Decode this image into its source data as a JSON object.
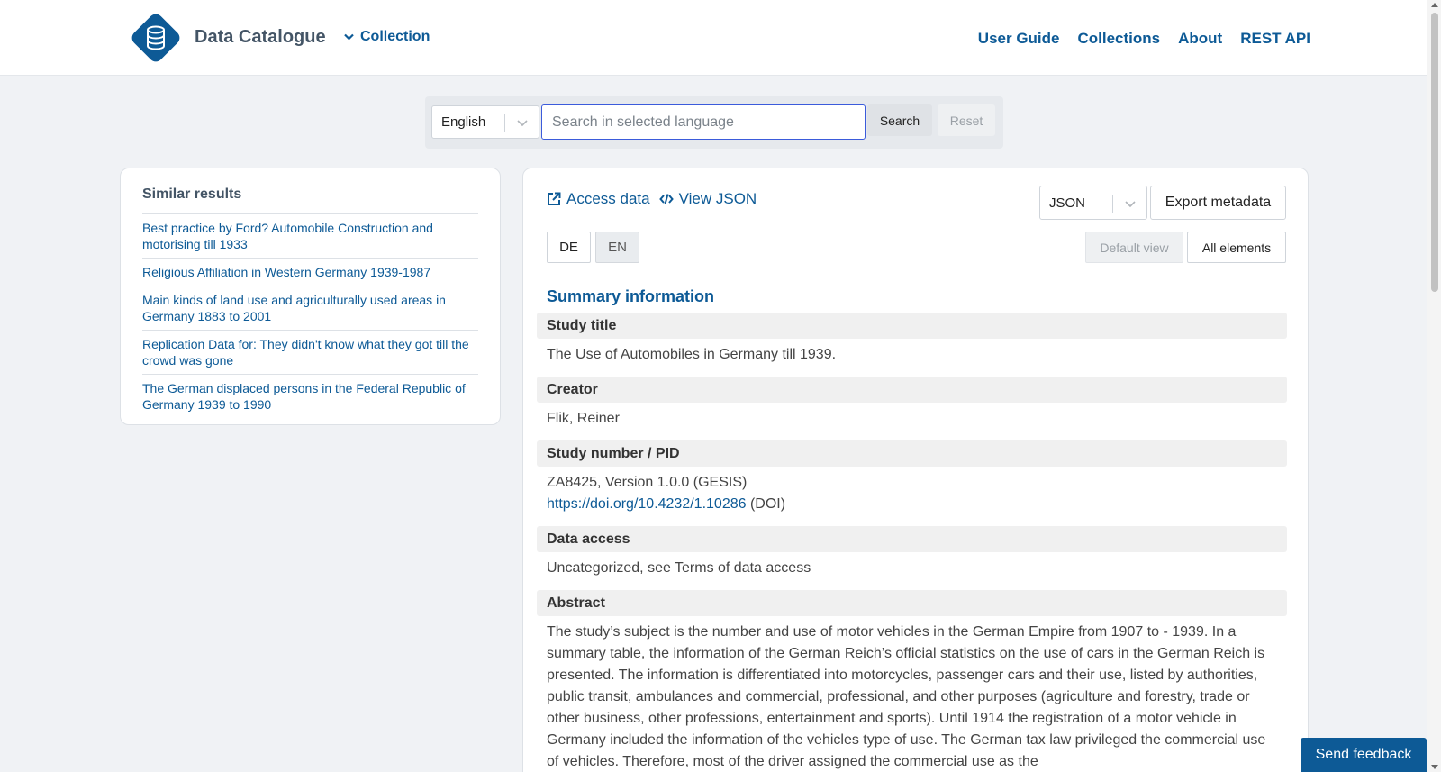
{
  "header": {
    "brand": "Data Catalogue",
    "collection_label": "Collection",
    "nav": [
      "User Guide",
      "Collections",
      "About",
      "REST API"
    ]
  },
  "search": {
    "language": "English",
    "placeholder": "Search in selected language",
    "search_label": "Search",
    "reset_label": "Reset"
  },
  "similar": {
    "title": "Similar results",
    "items": [
      "Best practice by Ford? Automobile Construction and motorising till 1933",
      "Religious Affiliation in Western Germany 1939-1987",
      "Main kinds of land use and agriculturally used areas in Germany 1883 to 2001",
      "Replication Data for: They didn't know what they got till the crowd was gone",
      "The German displaced persons in the Federal Republic of Germany 1939 to 1990"
    ]
  },
  "toolbar": {
    "access_data": "Access data",
    "view_json": "View JSON",
    "format": "JSON",
    "export_label": "Export metadata",
    "lang_de": "DE",
    "lang_en": "EN",
    "default_view": "Default view",
    "all_elements": "All elements"
  },
  "summary": {
    "title": "Summary information",
    "study_title_label": "Study title",
    "study_title": "The Use of Automobiles in Germany till 1939.",
    "creator_label": "Creator",
    "creator": "Flik, Reiner",
    "study_number_label": "Study number / PID",
    "study_number": "ZA8425, Version 1.0.0 (GESIS)",
    "doi_url": "https://doi.org/10.4232/1.10286",
    "doi_suffix": " (DOI)",
    "data_access_label": "Data access",
    "data_access": "Uncategorized, see Terms of data access",
    "abstract_label": "Abstract",
    "abstract": "The study’s subject is the number and use of motor vehicles in the German Empire from 1907 to - 1939. In a summary table, the information of the German Reich’s official statistics on the use of cars in the German Reich is presented. The information is differentiated into motorcycles, passenger cars and their use, listed by authorities, public transit, ambulances and commercial, professional, and other purposes (agriculture and forestry, trade or other business, other professions, entertainment and sports). Until 1914 the registration of a motor vehicle in Germany included the information of the vehicles type of use. The German tax law privileged the commercial use of vehicles. Therefore, most of the driver assigned the commercial use as the"
  },
  "feedback_label": "Send feedback",
  "colors": {
    "primary": "#0d5a96",
    "background": "#f0f2f5"
  }
}
